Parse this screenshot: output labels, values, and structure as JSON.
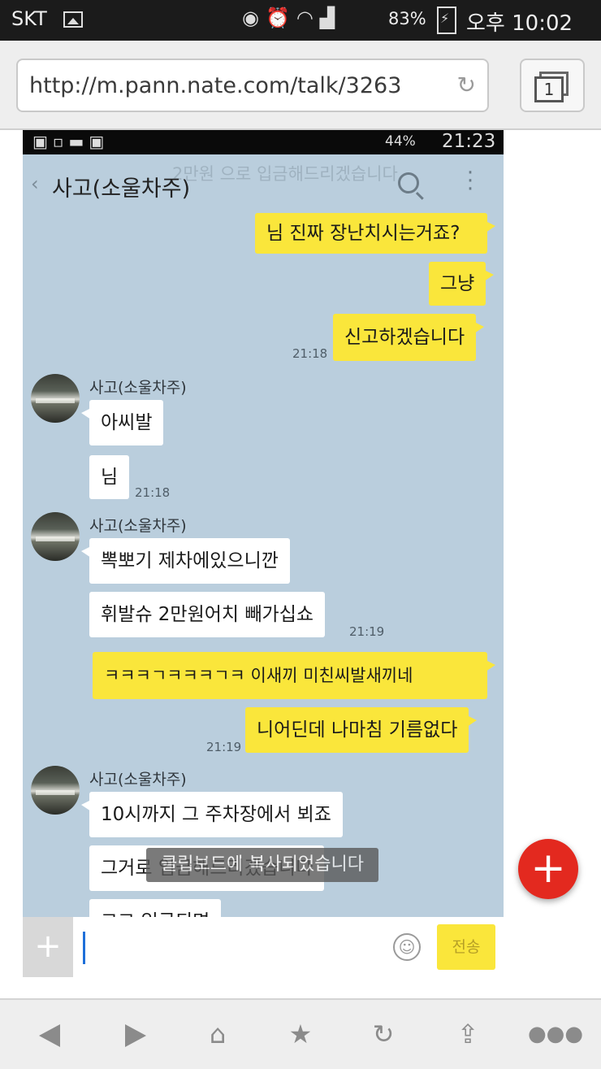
{
  "status_bar": {
    "carrier": "SKT",
    "battery": "83%",
    "time": "오후 10:02"
  },
  "browser": {
    "url": "http://m.pann.nate.com/talk/3263",
    "tab_count": "1"
  },
  "inner_status": {
    "battery": "44%",
    "time": "21:23"
  },
  "chat": {
    "title": "사고(소울차주)",
    "ghost_text": "2만원 으로 입금해드리겠습니다",
    "messages": [
      {
        "from": "me",
        "text": "님 진짜 장난치시는거죠?"
      },
      {
        "from": "me",
        "text": "그냥"
      },
      {
        "from": "me",
        "text": "신고하겠습니다",
        "time": "21:18"
      },
      {
        "from": "other",
        "sender": "사고(소울차주)",
        "text": "아씨발"
      },
      {
        "from": "other",
        "text": "님",
        "time": "21:18"
      },
      {
        "from": "other",
        "sender": "사고(소울차주)",
        "text": "뽁뽀기 제차에있으니깐"
      },
      {
        "from": "other",
        "text": "휘발슈 2만원어치 빼가십쇼",
        "time": "21:19"
      },
      {
        "from": "me",
        "text": "ㅋㅋㅋㄱㅋㅋㅋㄱㅋ 이새끼 미친씨발새끼네"
      },
      {
        "from": "me",
        "text": "니어딘데 나마침 기름없다",
        "time": "21:19"
      },
      {
        "from": "other",
        "sender": "사고(소울차주)",
        "text": "10시까지 그 주차장에서 뵈죠"
      },
      {
        "from": "other",
        "text": "그거로 입금해드리겠습니다"
      },
      {
        "from": "other",
        "text": "그그 입금되면"
      }
    ],
    "toast": "클립보드에 복사되었습니다",
    "send_label": "전송"
  },
  "colors": {
    "chat_bg": "#bacedd",
    "my_bubble": "#fae63b",
    "fab": "#e3291f"
  },
  "icons": [
    "gallery-icon",
    "eye-icon",
    "alarm-icon",
    "wifi-icon",
    "signal-icon",
    "battery-icon",
    "reload-icon",
    "tabs-icon",
    "search-icon",
    "menu-icon",
    "plus-icon",
    "emoji-icon",
    "back-icon",
    "forward-icon",
    "home-icon",
    "star-icon",
    "refresh-icon",
    "share-icon",
    "more-icon"
  ]
}
